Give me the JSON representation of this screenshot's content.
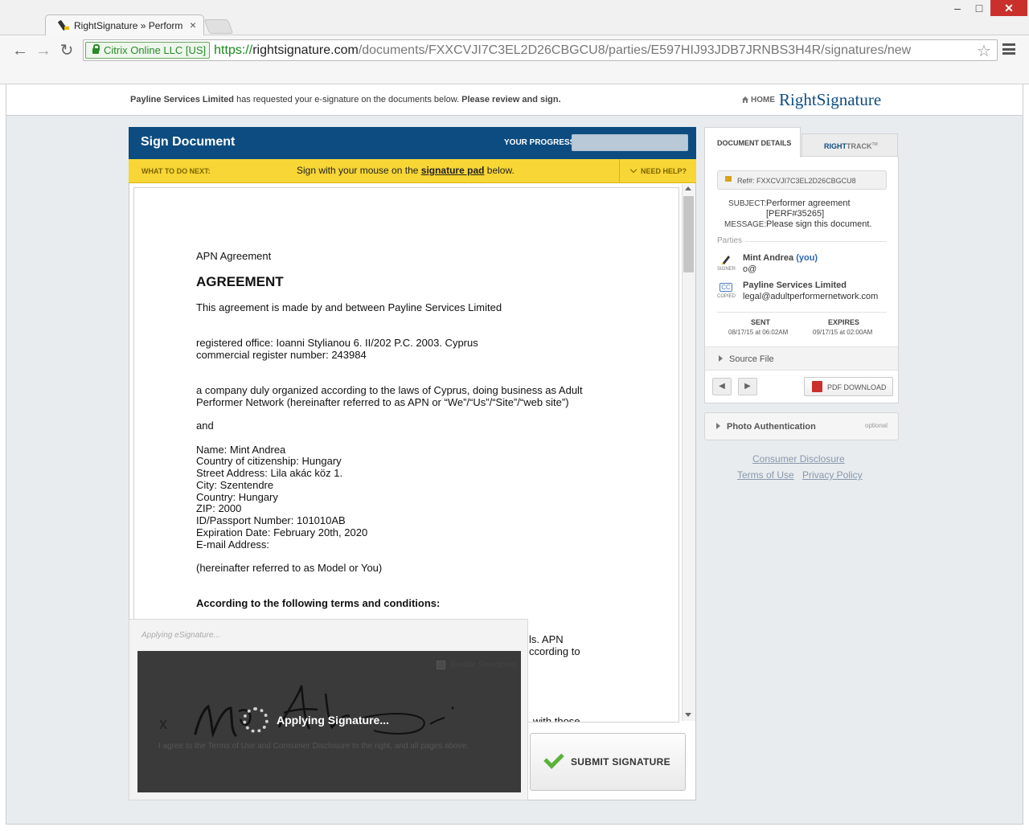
{
  "browser": {
    "tab_title": "RightSignature » Perform",
    "ev_badge": "Citrix Online LLC [US]",
    "url_scheme": "https://",
    "url_domain": "rightsignature.com",
    "url_path": "/documents/FXXCVJI7C3EL2D26CBGCU8/parties/E597HIJ93JDB7JRNBS3H4R/signatures/new"
  },
  "header": {
    "requester": "Payline Services Limited",
    "request_text": " has requested your e-signature on the documents below. ",
    "request_bold": "Please review and sign.",
    "home_label": "HOME",
    "logo_right": "Right",
    "logo_signature": "Signature"
  },
  "sign": {
    "title": "Sign Document",
    "progress_label": "YOUR PROGRESS",
    "progress_value": 1.0,
    "what_next": "WHAT TO DO NEXT:",
    "instr_pre": "Sign with your mouse on the ",
    "instr_link": "signature pad",
    "instr_post": " below.",
    "need_help": "NEED HELP?",
    "submit_label": "SUBMIT SIGNATURE"
  },
  "document": {
    "line1": "APN Agreement",
    "heading": "AGREEMENT",
    "line3": "This agreement is made by and between Payline Services Limited",
    "line4": "registered office: Ioanni Stylianou 6. II/202 P.C. 2003. Cyprus",
    "line5": "commercial register number: 243984",
    "line6": "a company duly organized according to the laws of Cyprus, doing business as Adult",
    "line7": "Performer Network (hereinafter referred to as APN or “We”/“Us”/“Site”/“web site”)",
    "line8": "and",
    "line9": "Name: Mint Andrea",
    "line10": "Country of citizenship: Hungary",
    "line11": "Street Address: Lila akác köz 1.",
    "line12": "City: Szentendre",
    "line13": "Country: Hungary",
    "line14": "ZIP: 2000",
    "line15": "ID/Passport Number: 101010AB",
    "line16": "Expiration Date: February 20th, 2020",
    "line17": "E-mail Address:",
    "line18": "(hereinafter referred to as Model or You)",
    "line19": "According to the following terms and conditions:",
    "frag1": "ls. APN",
    "frag2": "ccording to",
    "frag3": "with those"
  },
  "signature_pad": {
    "applying_label": "Applying eSignature...",
    "enable_smoothing": "Enable Smoothing",
    "x_mark": "x",
    "agree_text": "I agree to the Terms of Use and Consumer Disclosure to the right, and all pages above.",
    "overlay": "Applying Signature..."
  },
  "details": {
    "tab_details": "DOCUMENT DETAILS",
    "tab_track_a": "RIGHT",
    "tab_track_b": "TRACK",
    "tab_track_tm": "TM",
    "ref_label": "Ref#:",
    "ref": "FXXCVJI7C3EL2D26CBGCU8",
    "subject_label": "SUBJECT:",
    "subject_1": "Performer agreement",
    "subject_2": "[PERF#35265]",
    "message_label": "MESSAGE:",
    "message": "Please sign this document.",
    "parties_label": "Parties",
    "signer_name": "Mint Andrea",
    "signer_you": " (you)",
    "signer_email": "o@",
    "signer_tag": "SIGNER",
    "copied_icon": "CC",
    "copied_tag": "COPIED",
    "copied_name": "Payline Services Limited",
    "copied_email": "legal@adultperformernetwork.com",
    "sent_label": "SENT",
    "sent": "08/17/15 at 06:02AM",
    "expires_label": "EXPIRES",
    "expires": "09/17/15 at 02:00AM",
    "source_file": "Source File",
    "pdf_download": "PDF DOWNLOAD",
    "photo_auth": "Photo Authentication",
    "optional": "optional",
    "consumer_disclosure": "Consumer Disclosure",
    "terms": "Terms of Use",
    "privacy": "Privacy Policy"
  }
}
